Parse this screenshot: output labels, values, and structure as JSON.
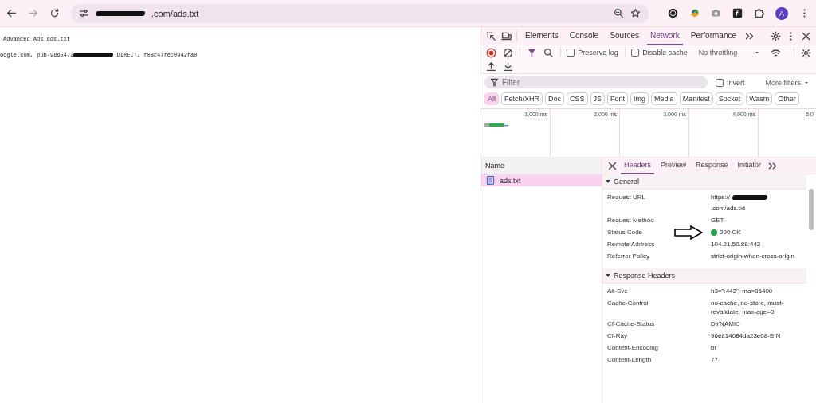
{
  "browser": {
    "address": {
      "url_tail": ".com/ads.txt",
      "redacted": true
    },
    "avatar_letter": "A"
  },
  "page": {
    "lines": [
      {
        "before": "Advanced Ads ads.txt"
      },
      {
        "before": "oogle.com, pub-9865472",
        "redacted": true,
        "after": " DIRECT, f08c47fec0942fa0"
      }
    ]
  },
  "devtools": {
    "tabs": [
      {
        "label": "Elements",
        "selected": false
      },
      {
        "label": "Console",
        "selected": false
      },
      {
        "label": "Sources",
        "selected": false
      },
      {
        "label": "Network",
        "selected": true
      },
      {
        "label": "Performance",
        "selected": false
      }
    ],
    "toolbar": {
      "recording": true,
      "preserve_log": {
        "label": "Preserve log",
        "checked": false
      },
      "disable_cache": {
        "label": "Disable cache",
        "checked": false
      },
      "throttling": "No throttling"
    },
    "filter": {
      "placeholder": "Filter",
      "invert": {
        "label": "Invert",
        "checked": false
      },
      "more_filters": "More filters"
    },
    "type_filters": [
      {
        "label": "All",
        "selected": true
      },
      {
        "label": "Fetch/XHR",
        "selected": false
      },
      {
        "label": "Doc",
        "selected": false
      },
      {
        "label": "CSS",
        "selected": false
      },
      {
        "label": "JS",
        "selected": false
      },
      {
        "label": "Font",
        "selected": false
      },
      {
        "label": "Img",
        "selected": false
      },
      {
        "label": "Media",
        "selected": false
      },
      {
        "label": "Manifest",
        "selected": false
      },
      {
        "label": "Socket",
        "selected": false
      },
      {
        "label": "Wasm",
        "selected": false
      },
      {
        "label": "Other",
        "selected": false
      }
    ],
    "timeline_ticks": [
      "1,000 ms",
      "2,000 ms",
      "3,000 ms",
      "4,000 ms",
      "5,0"
    ],
    "requests": {
      "column": "Name",
      "rows": [
        {
          "name": "ads.txt",
          "selected": true
        }
      ]
    },
    "detail_tabs": [
      {
        "label": "Headers",
        "selected": true
      },
      {
        "label": "Preview",
        "selected": false
      },
      {
        "label": "Response",
        "selected": false
      },
      {
        "label": "Initiator",
        "selected": false
      }
    ],
    "sections": [
      {
        "title": "General",
        "expanded": true,
        "rows": [
          {
            "name": "Request URL",
            "kind": "redacted_url",
            "value_before": "https://",
            "value": ".com/ads.txt"
          },
          {
            "name": "Request Method",
            "kind": "text",
            "value": "GET"
          },
          {
            "name": "Status Code",
            "kind": "status",
            "value": "200 OK",
            "color": "#1ea446",
            "annotated": true
          },
          {
            "name": "Remote Address",
            "kind": "text",
            "value": "104.21.50.88:443"
          },
          {
            "name": "Referrer Policy",
            "kind": "text",
            "value": "strict-origin-when-cross-origin"
          }
        ]
      },
      {
        "title": "Response Headers",
        "expanded": true,
        "rows": [
          {
            "name": "Alt-Svc",
            "kind": "text",
            "value": "h3=\":443\"; ma=86400"
          },
          {
            "name": "Cache-Control",
            "kind": "text",
            "value": "no-cache, no-store, must-revalidate, max-age=0"
          },
          {
            "name": "Cf-Cache-Status",
            "kind": "text",
            "value": "DYNAMIC"
          },
          {
            "name": "Cf-Ray",
            "kind": "text",
            "value": "96e814084da23e08-SIN"
          },
          {
            "name": "Content-Encoding",
            "kind": "text",
            "value": "br"
          },
          {
            "name": "Content-Length",
            "kind": "text",
            "value": "77"
          }
        ]
      }
    ]
  }
}
